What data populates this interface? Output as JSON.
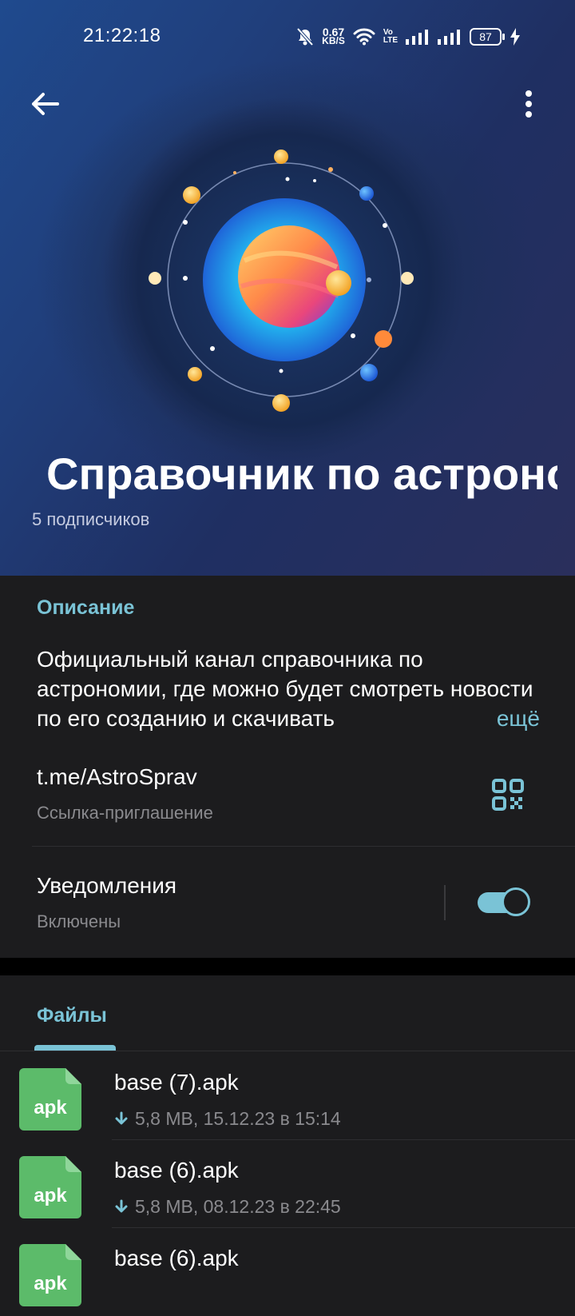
{
  "status_bar": {
    "time": "21:22:18",
    "net_speed": "0.67",
    "net_unit": "KB/S",
    "volte_top": "Vo",
    "volte_bottom": "LTE",
    "battery": "87"
  },
  "header": {
    "channel_title": "Справочник по астрономии",
    "subscribers": "5 подписчиков",
    "colors": {
      "bg_top": "#1f4a8e",
      "bg_bottom": "#2a2f5c"
    }
  },
  "info": {
    "description_label": "Описание",
    "description_text": "Официальный канал справочника по астрономии, где можно будет смотреть новости по его созданию и скачивать",
    "more_label": "ещё",
    "link": "t.me/AstroSprav",
    "link_sub": "Ссылка-приглашение",
    "notifications_title": "Уведомления",
    "notifications_sub": "Включены",
    "notifications_on": true
  },
  "files_section": {
    "label": "Файлы",
    "items": [
      {
        "name": "base (7).apk",
        "meta": "5,8 MB, 15.12.23 в 15:14",
        "ext": "apk"
      },
      {
        "name": "base (6).apk",
        "meta": "5,8 MB, 08.12.23 в 22:45",
        "ext": "apk"
      },
      {
        "name": "base (6).apk",
        "meta": "",
        "ext": "apk"
      }
    ]
  },
  "accent_color": "#7ac3d6",
  "file_icon_color": "#5cbb6a",
  "icons": [
    "back-arrow-icon",
    "more-vertical-icon",
    "qr-code-icon",
    "download-arrow-icon",
    "apk-file-icon",
    "mute-bell-icon",
    "wifi-icon",
    "signal-icon",
    "battery-icon",
    "charging-icon"
  ]
}
